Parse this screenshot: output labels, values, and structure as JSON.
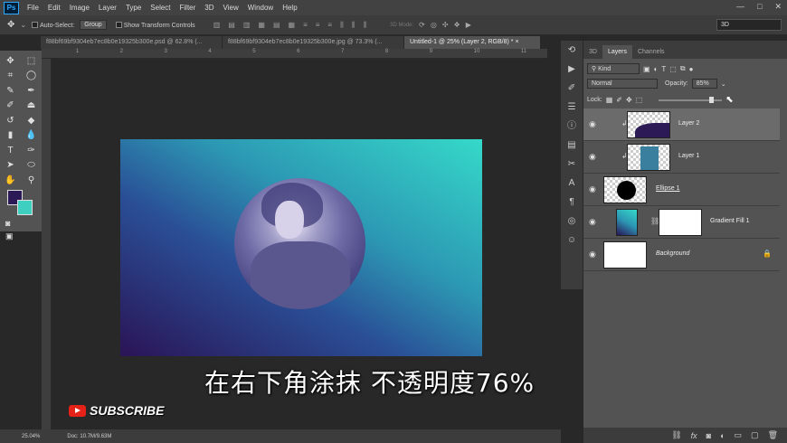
{
  "menubar": {
    "logo": "Ps",
    "items": [
      "File",
      "Edit",
      "Image",
      "Layer",
      "Type",
      "Select",
      "Filter",
      "3D",
      "View",
      "Window",
      "Help"
    ],
    "win_controls": [
      "—",
      "□",
      "✕"
    ]
  },
  "options": {
    "auto_select_label": "Auto-Select:",
    "auto_select_value": "Group",
    "show_transform_label": "Show Transform Controls",
    "mode_3d_label": "3D Mode:",
    "workspace": "3D"
  },
  "tabs": [
    {
      "label": "f88bf69bf9304eb7ec8b0e19325b300e.psd @ 62.8% (...",
      "close": "×"
    },
    {
      "label": "f88bf69bf9304eb7ec8b0e19325b300e.jpg @ 73.3% (...",
      "close": "×"
    },
    {
      "label": "Untitled-1 @ 25% (Layer 2, RGB/8) *",
      "close": "×"
    }
  ],
  "colors": {
    "foreground": "#2b1a56",
    "background": "#3ecfc0",
    "accent": "#31a8ff"
  },
  "layers_panel": {
    "tabs": [
      "3D",
      "Layers",
      "Channels"
    ],
    "kind_label": "Kind",
    "blend_mode": "Normal",
    "opacity_label": "Opacity:",
    "opacity_value": "85%",
    "lock_label": "Lock:",
    "layers": [
      {
        "name": "Layer 2",
        "selected": true,
        "clipped": true
      },
      {
        "name": "Layer 1",
        "selected": false,
        "clipped": true
      },
      {
        "name": "Ellipse 1",
        "selected": false,
        "clipped": false
      },
      {
        "name": "Gradient Fill 1",
        "selected": false,
        "clipped": false
      },
      {
        "name": "Background",
        "selected": false,
        "clipped": false
      }
    ],
    "footer_icons": [
      "link-icon",
      "fx-icon",
      "mask-icon",
      "adjustment-icon",
      "folder-icon",
      "new-layer-icon",
      "trash-icon"
    ]
  },
  "status": {
    "zoom": "25.04%",
    "doc": "Doc: 10.7M/9.63M"
  },
  "subtitle": "在右下角涂抹 不透明度76%",
  "subscribe": "SUBSCRIBE"
}
